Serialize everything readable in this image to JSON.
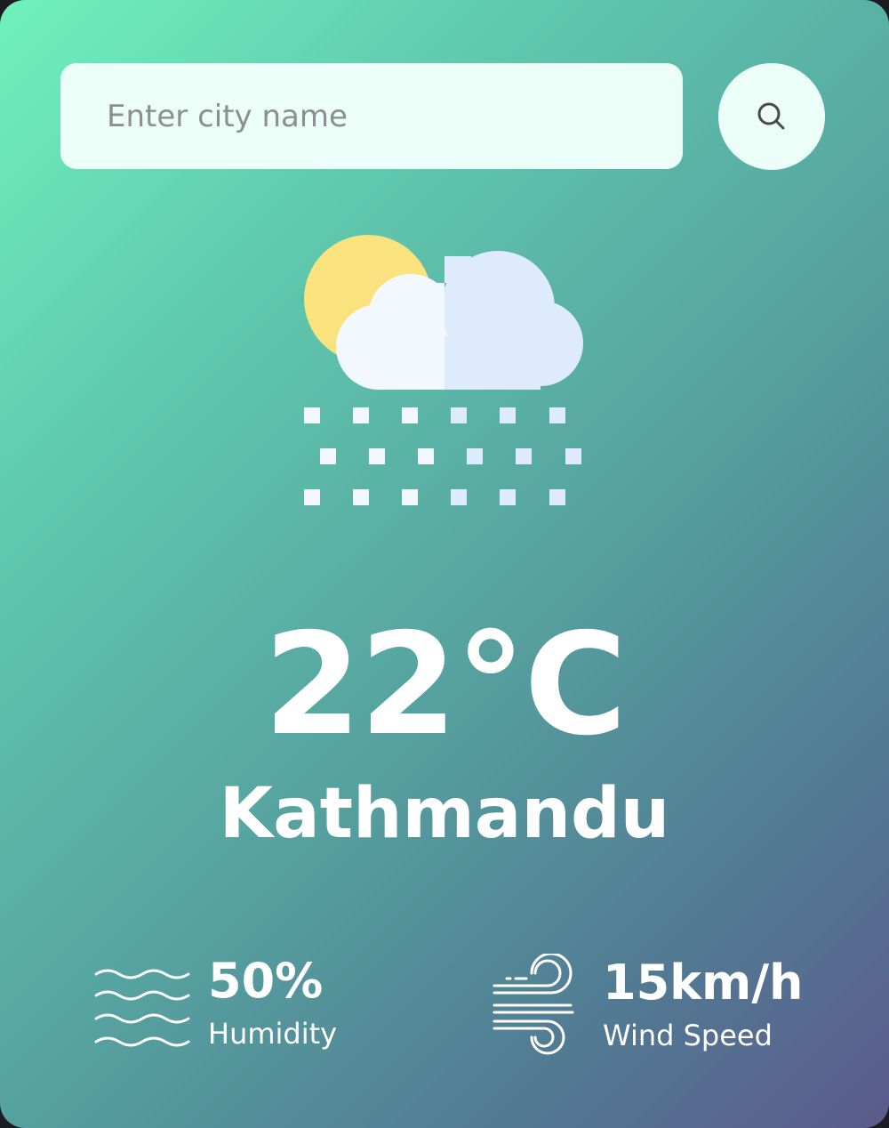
{
  "search": {
    "placeholder": "Enter city name",
    "value": "",
    "button_icon": "search-icon"
  },
  "weather": {
    "icon": "snow-sun-cloud-icon",
    "temperature": "22°C",
    "city": "Kathmandu"
  },
  "details": {
    "humidity": {
      "icon": "humidity-waves-icon",
      "value": "50%",
      "label": "Humidity"
    },
    "wind": {
      "icon": "wind-icon",
      "value": "15km/h",
      "label": "Wind Speed"
    }
  },
  "colors": {
    "gradient_start": "#6ff1bd",
    "gradient_end": "#5b5a8c",
    "input_bg": "#ebfef7",
    "sun": "#fae37e",
    "cloud_light": "#f3f8fe",
    "cloud_shade": "#deebfd"
  }
}
